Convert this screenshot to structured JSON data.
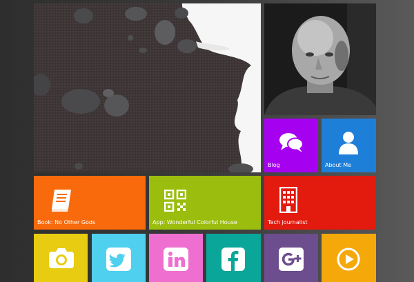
{
  "colors": {
    "background": "#3a3a3a",
    "blog": "#a600f0",
    "about": "#1e7fd9",
    "book": "#f96a0c",
    "app": "#9bbd0e",
    "tech": "#e31a0e",
    "camera": "#e8cc11",
    "twitter": "#4fd0ee",
    "linkedin": "#ef6fd0",
    "facebook": "#0aa69a",
    "gplus": "#6c4d8e",
    "video": "#f5a80a"
  },
  "tiles": {
    "blog": {
      "label": "Blog",
      "icon": "speech-bubbles-icon"
    },
    "about": {
      "label": "About Me",
      "icon": "user-icon"
    },
    "book": {
      "label": "Book: No Other Gods",
      "icon": "book-icon"
    },
    "app": {
      "label": "App: Wonderful Colorful House",
      "icon": "qr-code-icon"
    },
    "tech": {
      "label": "Tech journalist",
      "icon": "building-icon"
    },
    "camera": {
      "label": "",
      "icon": "camera-icon"
    },
    "twitter": {
      "label": "",
      "icon": "twitter-icon"
    },
    "linkedin": {
      "label": "",
      "icon": "linkedin-icon"
    },
    "facebook": {
      "label": "",
      "icon": "facebook-icon"
    },
    "gplus": {
      "label": "",
      "icon": "google-plus-icon"
    },
    "video": {
      "label": "",
      "icon": "play-icon"
    }
  }
}
